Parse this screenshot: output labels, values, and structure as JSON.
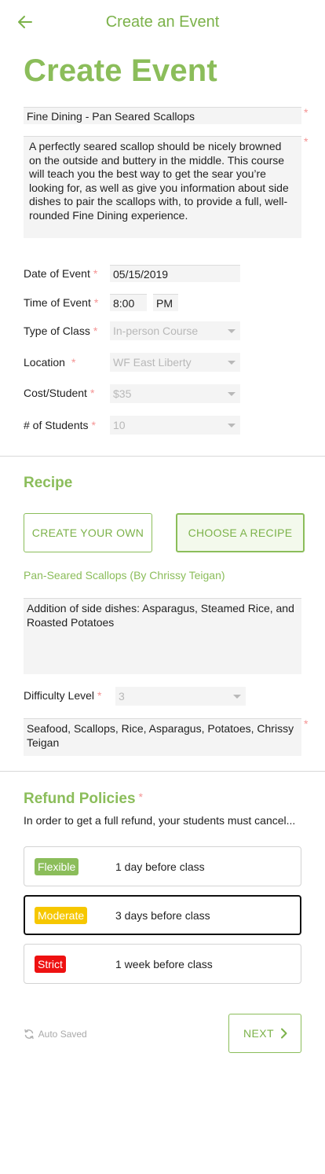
{
  "header": {
    "title": "Create an Event",
    "back_icon": "arrow-left-icon"
  },
  "page_title": "Create Event",
  "event": {
    "title": "Fine Dining - Pan Seared Scallops",
    "description": "A perfectly seared scallop should be nicely browned on the outside and buttery in the middle. This course will teach you the best way to get the sear you’re looking for, as well as give you information about side dishes to pair the scallops with, to provide a full, well-rounded Fine Dining experience."
  },
  "required_mark": "*",
  "fields": {
    "date_label": "Date of Event",
    "date_value": "05/15/2019",
    "time_label": "Time of Event",
    "time_value": "8:00",
    "time_period": "PM",
    "class_type_label": "Type of Class",
    "class_type_value": "In-person Course",
    "location_label": "Location",
    "location_value": "WF East Liberty",
    "cost_label": "Cost/Student",
    "cost_value": "$35",
    "students_label": "# of Students",
    "students_value": "10"
  },
  "recipe": {
    "section_title": "Recipe",
    "create_own_label": "CREATE YOUR OWN",
    "choose_recipe_label": "CHOOSE A RECIPE",
    "selected_option": "CHOOSE A RECIPE",
    "selected_recipe": "Pan-Seared Scallops (By Chrissy Teigan)",
    "notes": "Addition of side dishes: Asparagus, Steamed Rice, and Roasted Potatoes",
    "difficulty_label": "Difficulty Level",
    "difficulty_value": "3",
    "tags": "Seafood, Scallops, Rice, Asparagus, Potatoes, Chrissy Teigan"
  },
  "refund": {
    "section_title": "Refund Policies",
    "intro": "In order to get a full refund, your students must cancel...",
    "selected": "Moderate",
    "policies": [
      {
        "badge": "Flexible",
        "text": "1 day before class",
        "color": "#8bbd5a"
      },
      {
        "badge": "Moderate",
        "text": "3 days before class",
        "color": "#f6c700"
      },
      {
        "badge": "Strict",
        "text": "1 week before class",
        "color": "#ee1111"
      }
    ]
  },
  "footer": {
    "autosave_label": "Auto Saved",
    "next_label": "NEXT"
  },
  "colors": {
    "brand_green": "#8bbd5a",
    "required_red": "#f49393",
    "field_bg": "#f4f4f4"
  }
}
